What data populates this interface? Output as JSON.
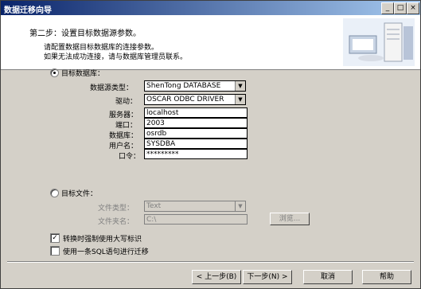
{
  "window": {
    "title": "数据迁移向导",
    "min_icon": "_",
    "max_icon": "□",
    "close_icon": "×"
  },
  "header": {
    "step": "第二步：设置目标数据源参数。",
    "desc_line1": "请配置数据目标数据库的连接参数。",
    "desc_line2": "如果无法成功连接，请与数据库管理员联系。"
  },
  "target_db": {
    "radio_label": "目标数据库：",
    "selected": true,
    "datasource_type_label": "数据源类型：",
    "datasource_type_value": "ShenTong DATABASE",
    "driver_label": "驱动：",
    "driver_value": "OSCAR ODBC DRIVER",
    "server_label": "服务器：",
    "server_value": "localhost",
    "port_label": "端口：",
    "port_value": "2003",
    "database_label": "数据库：",
    "database_value": "osrdb",
    "username_label": "用户名：",
    "username_value": "SYSDBA",
    "password_label": "口令：",
    "password_value": "*********"
  },
  "target_file": {
    "radio_label": "目标文件：",
    "selected": false,
    "file_type_label": "文件类型：",
    "file_type_value": "Text",
    "folder_label": "文件夹名：",
    "folder_value": "C:\\",
    "browse_label": "浏览..."
  },
  "options": {
    "uppercase_label": "转换时强制使用大写标识",
    "uppercase_checked": true,
    "uppercase_mark": "✓",
    "single_sql_label": "使用一条SQL语句进行迁移",
    "single_sql_checked": false
  },
  "buttons": {
    "prev": "< 上一步(B)",
    "next": "下一步(N) >",
    "cancel": "取消",
    "help": "帮助"
  },
  "colors": {
    "titlebar_start": "#0a246a",
    "titlebar_end": "#a6caf0",
    "dialog_bg": "#d4d0c8"
  }
}
